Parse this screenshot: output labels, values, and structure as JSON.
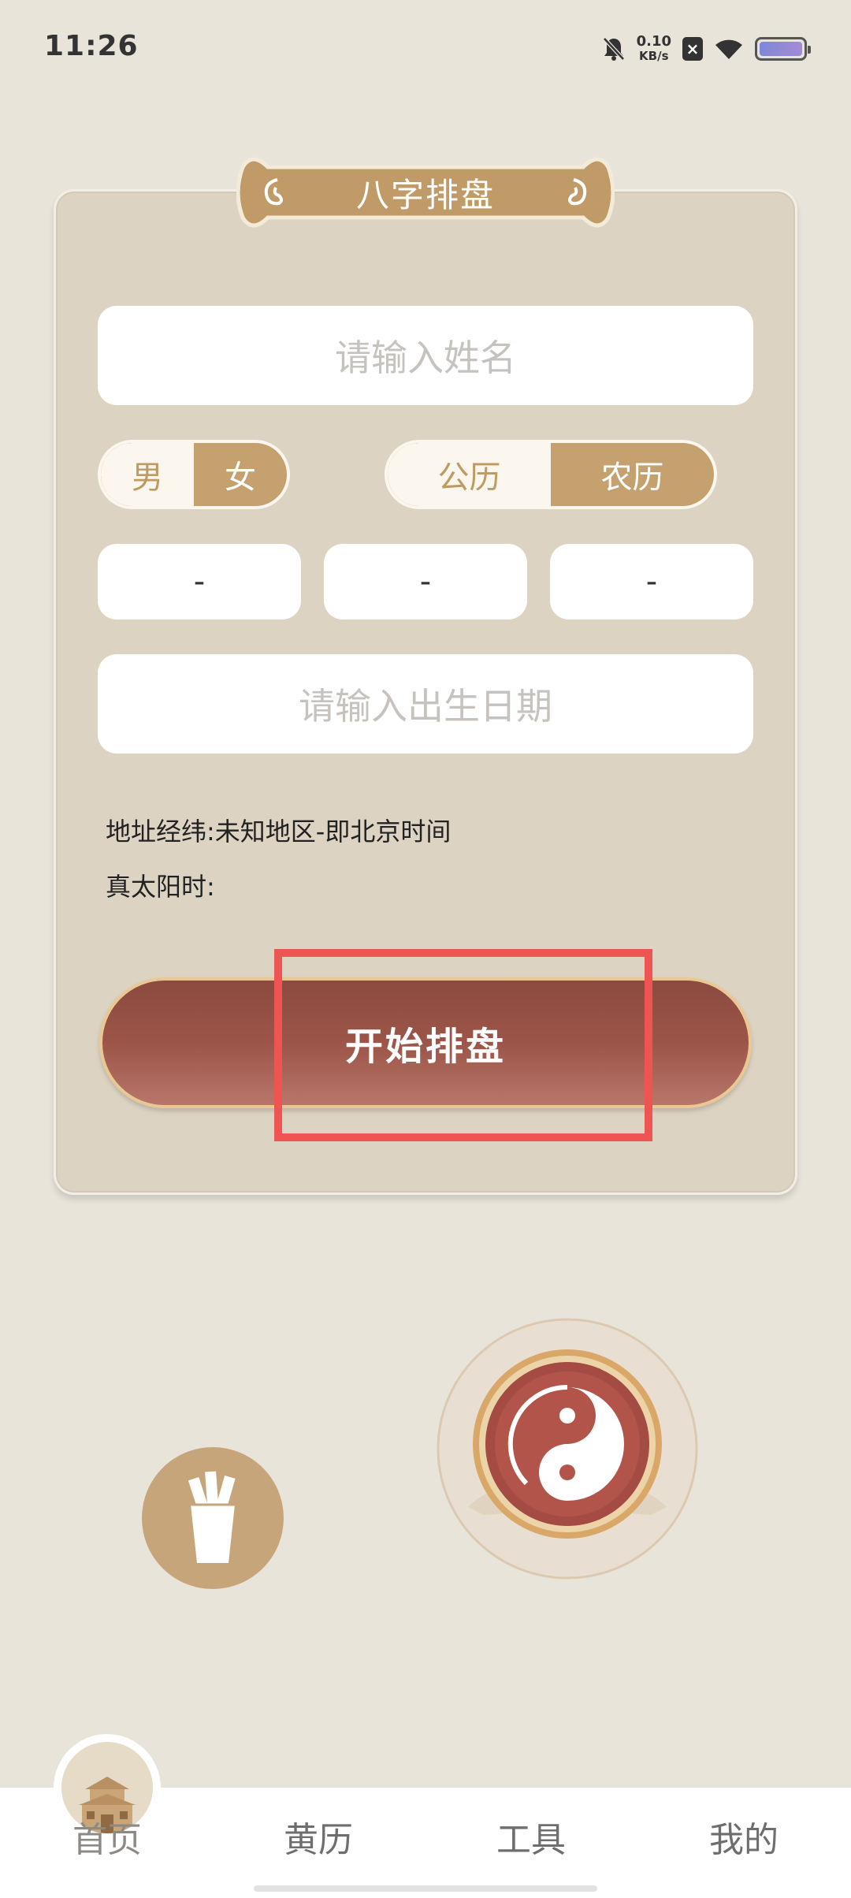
{
  "status_bar": {
    "time": "11:26",
    "net_speed_value": "0.10",
    "net_speed_unit": "KB/s",
    "icons": [
      "bell-muted-icon",
      "sim-x-icon",
      "wifi-icon",
      "battery-icon"
    ]
  },
  "card": {
    "title": "八字排盘",
    "name_placeholder": "请输入姓名",
    "gender": {
      "options": [
        "男",
        "女"
      ],
      "selected": "男"
    },
    "calendar": {
      "options": [
        "公历",
        "农历"
      ],
      "selected": "公历"
    },
    "date_fields": [
      "-",
      "-",
      "-"
    ],
    "birth_placeholder": "请输入出生日期",
    "address_line": "地址经纬:未知地区-即北京时间",
    "solar_time_line": "真太阳时:",
    "start_button": "开始排盘"
  },
  "floating": {
    "left_icon": "fortune-sticks-icon",
    "right_icon": "yin-yang-icon"
  },
  "bottom_nav": {
    "items": [
      {
        "label": "首页",
        "icon": "temple-icon",
        "active": true
      },
      {
        "label": "黄历"
      },
      {
        "label": "工具"
      },
      {
        "label": "我的"
      }
    ]
  },
  "colors": {
    "background": "#e9e4da",
    "card": "#ddd3c3",
    "gold": "#c4a16f",
    "button_red": "#9c5548",
    "highlight": "#ee5452"
  }
}
